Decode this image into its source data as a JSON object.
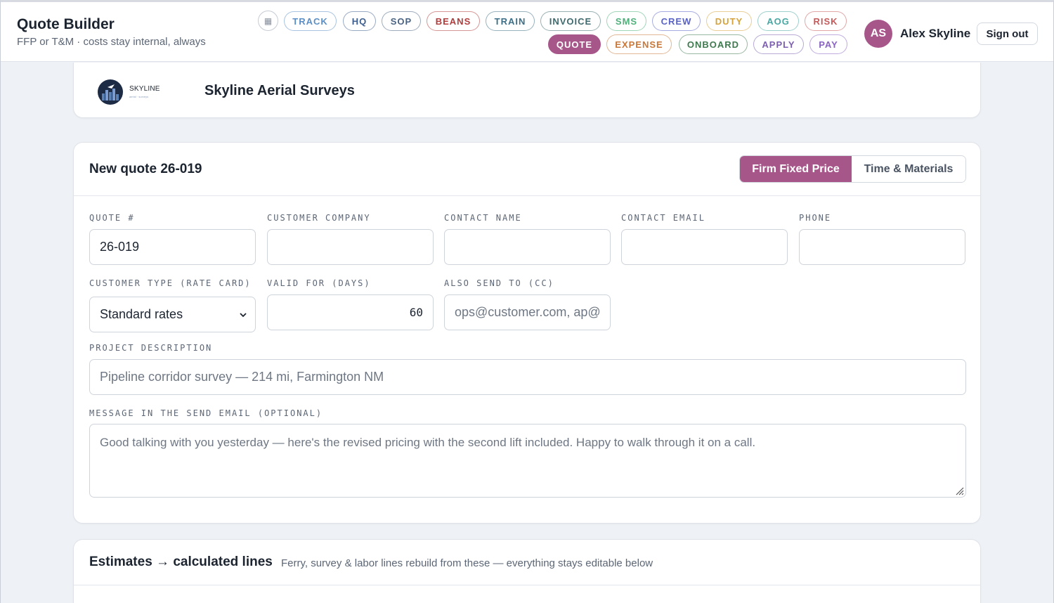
{
  "header": {
    "title": "Quote Builder",
    "subtitle": "FFP or T&M · costs stay internal, always",
    "grid_icon": "grid-icon",
    "nav_row1": [
      {
        "label": "TRACK",
        "color": "#5b8fc7"
      },
      {
        "label": "HQ",
        "color": "#3d5f8f"
      },
      {
        "label": "SOP",
        "color": "#4a6383"
      },
      {
        "label": "BEANS",
        "color": "#b23b3b"
      },
      {
        "label": "TRAIN",
        "color": "#3e6f86"
      },
      {
        "label": "INVOICE",
        "color": "#3f6a6e"
      },
      {
        "label": "SMS",
        "color": "#4fb07a"
      },
      {
        "label": "CREW",
        "color": "#5a63c4"
      },
      {
        "label": "DUTY",
        "color": "#d6a33a"
      },
      {
        "label": "AOG",
        "color": "#4aa7a2"
      },
      {
        "label": "RISK",
        "color": "#c65a5a"
      }
    ],
    "nav_row2": [
      {
        "label": "QUOTE",
        "color": "#a7568a",
        "active": true
      },
      {
        "label": "EXPENSE",
        "color": "#c9783a"
      },
      {
        "label": "ONBOARD",
        "color": "#3f7a4f"
      },
      {
        "label": "APPLY",
        "color": "#7c5fb0"
      },
      {
        "label": "PAY",
        "color": "#8a63c4"
      }
    ],
    "user": {
      "initials": "AS",
      "name": "Alex Skyline"
    },
    "signout_label": "Sign out",
    "accent": "#a7568a"
  },
  "company": {
    "logo_text": "SKYLINE",
    "logo_tagline": "aerial · surveys",
    "name": "Skyline Aerial Surveys"
  },
  "quote": {
    "title": "New quote 26-019",
    "pricing_modes": [
      "Firm Fixed Price",
      "Time & Materials"
    ],
    "selected_mode": "Firm Fixed Price",
    "fields": {
      "quote_no": {
        "label": "QUOTE #",
        "value": "26-019"
      },
      "customer_company": {
        "label": "CUSTOMER COMPANY",
        "value": ""
      },
      "contact_name": {
        "label": "CONTACT NAME",
        "value": ""
      },
      "contact_email": {
        "label": "CONTACT EMAIL",
        "value": ""
      },
      "phone": {
        "label": "PHONE",
        "value": ""
      },
      "customer_type": {
        "label": "CUSTOMER TYPE (RATE CARD)",
        "value": "Standard rates"
      },
      "valid_for": {
        "label": "VALID FOR (DAYS)",
        "value": "60"
      },
      "cc": {
        "label": "ALSO SEND TO (CC)",
        "placeholder": "ops@customer.com, ap@"
      },
      "description": {
        "label": "PROJECT DESCRIPTION",
        "placeholder": "Pipeline corridor survey — 214 mi, Farmington NM"
      },
      "message": {
        "label": "MESSAGE IN THE SEND EMAIL (OPTIONAL)",
        "placeholder": "Good talking with you yesterday — here's the revised pricing with the second lift included. Happy to walk through it on a call."
      }
    }
  },
  "estimates": {
    "title": "Estimates → calculated lines",
    "subtitle": "Ferry, survey & labor lines rebuild from these — everything stays editable below"
  }
}
